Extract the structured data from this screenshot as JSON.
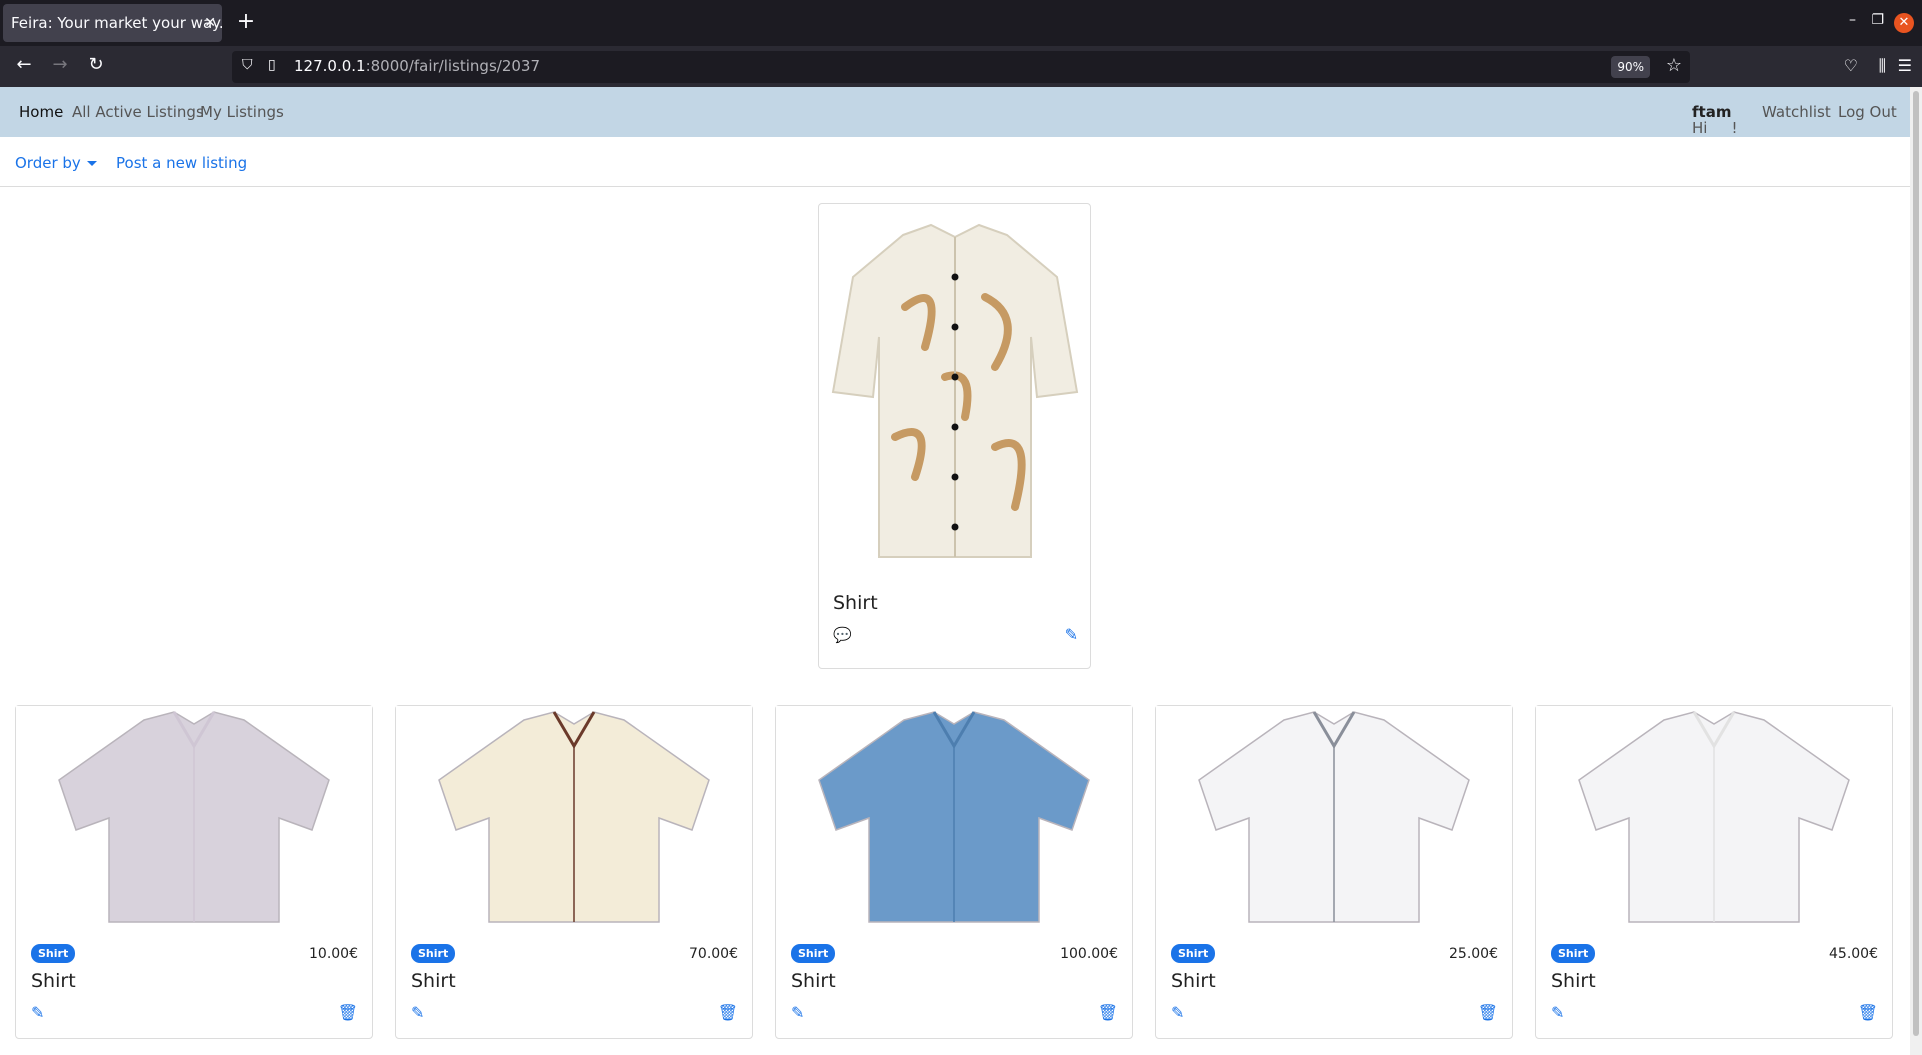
{
  "browser": {
    "tab_title": "Feira: Your market your way.",
    "url_host": "127.0.0.1",
    "url_rest": ":8000/fair/listings/2037",
    "zoom": "90%"
  },
  "navbar": {
    "home": "Home",
    "all_active": "All Active Listings",
    "my_listings": "My Listings",
    "greeting_prefix": "Hi",
    "username": "ftam",
    "greeting_suffix": "!",
    "watchlist": "Watchlist",
    "logout": "Log Out"
  },
  "subnav": {
    "order_by": "Order by",
    "post_new": "Post a new listing"
  },
  "featured": {
    "title": "Shirt",
    "image": "shirt-cream-palm-leaf-print"
  },
  "listings": [
    {
      "badge": "Shirt",
      "price": "10.00€",
      "title": "Shirt",
      "image": "shirt-lilac-short-sleeve"
    },
    {
      "badge": "Shirt",
      "price": "70.00€",
      "title": "Shirt",
      "image": "shirt-hawaiian-canoe-print"
    },
    {
      "badge": "Shirt",
      "price": "100.00€",
      "title": "Shirt",
      "image": "shirt-denim-long-sleeve"
    },
    {
      "badge": "Shirt",
      "price": "25.00€",
      "title": "Shirt",
      "image": "shirt-white-polo-tipped"
    },
    {
      "badge": "Shirt",
      "price": "45.00€",
      "title": "Shirt",
      "image": "shirt-white-polo"
    }
  ],
  "colors": {
    "navbar_bg": "#c2d6e5",
    "link": "#1a73e8",
    "badge": "#1a73e8"
  }
}
